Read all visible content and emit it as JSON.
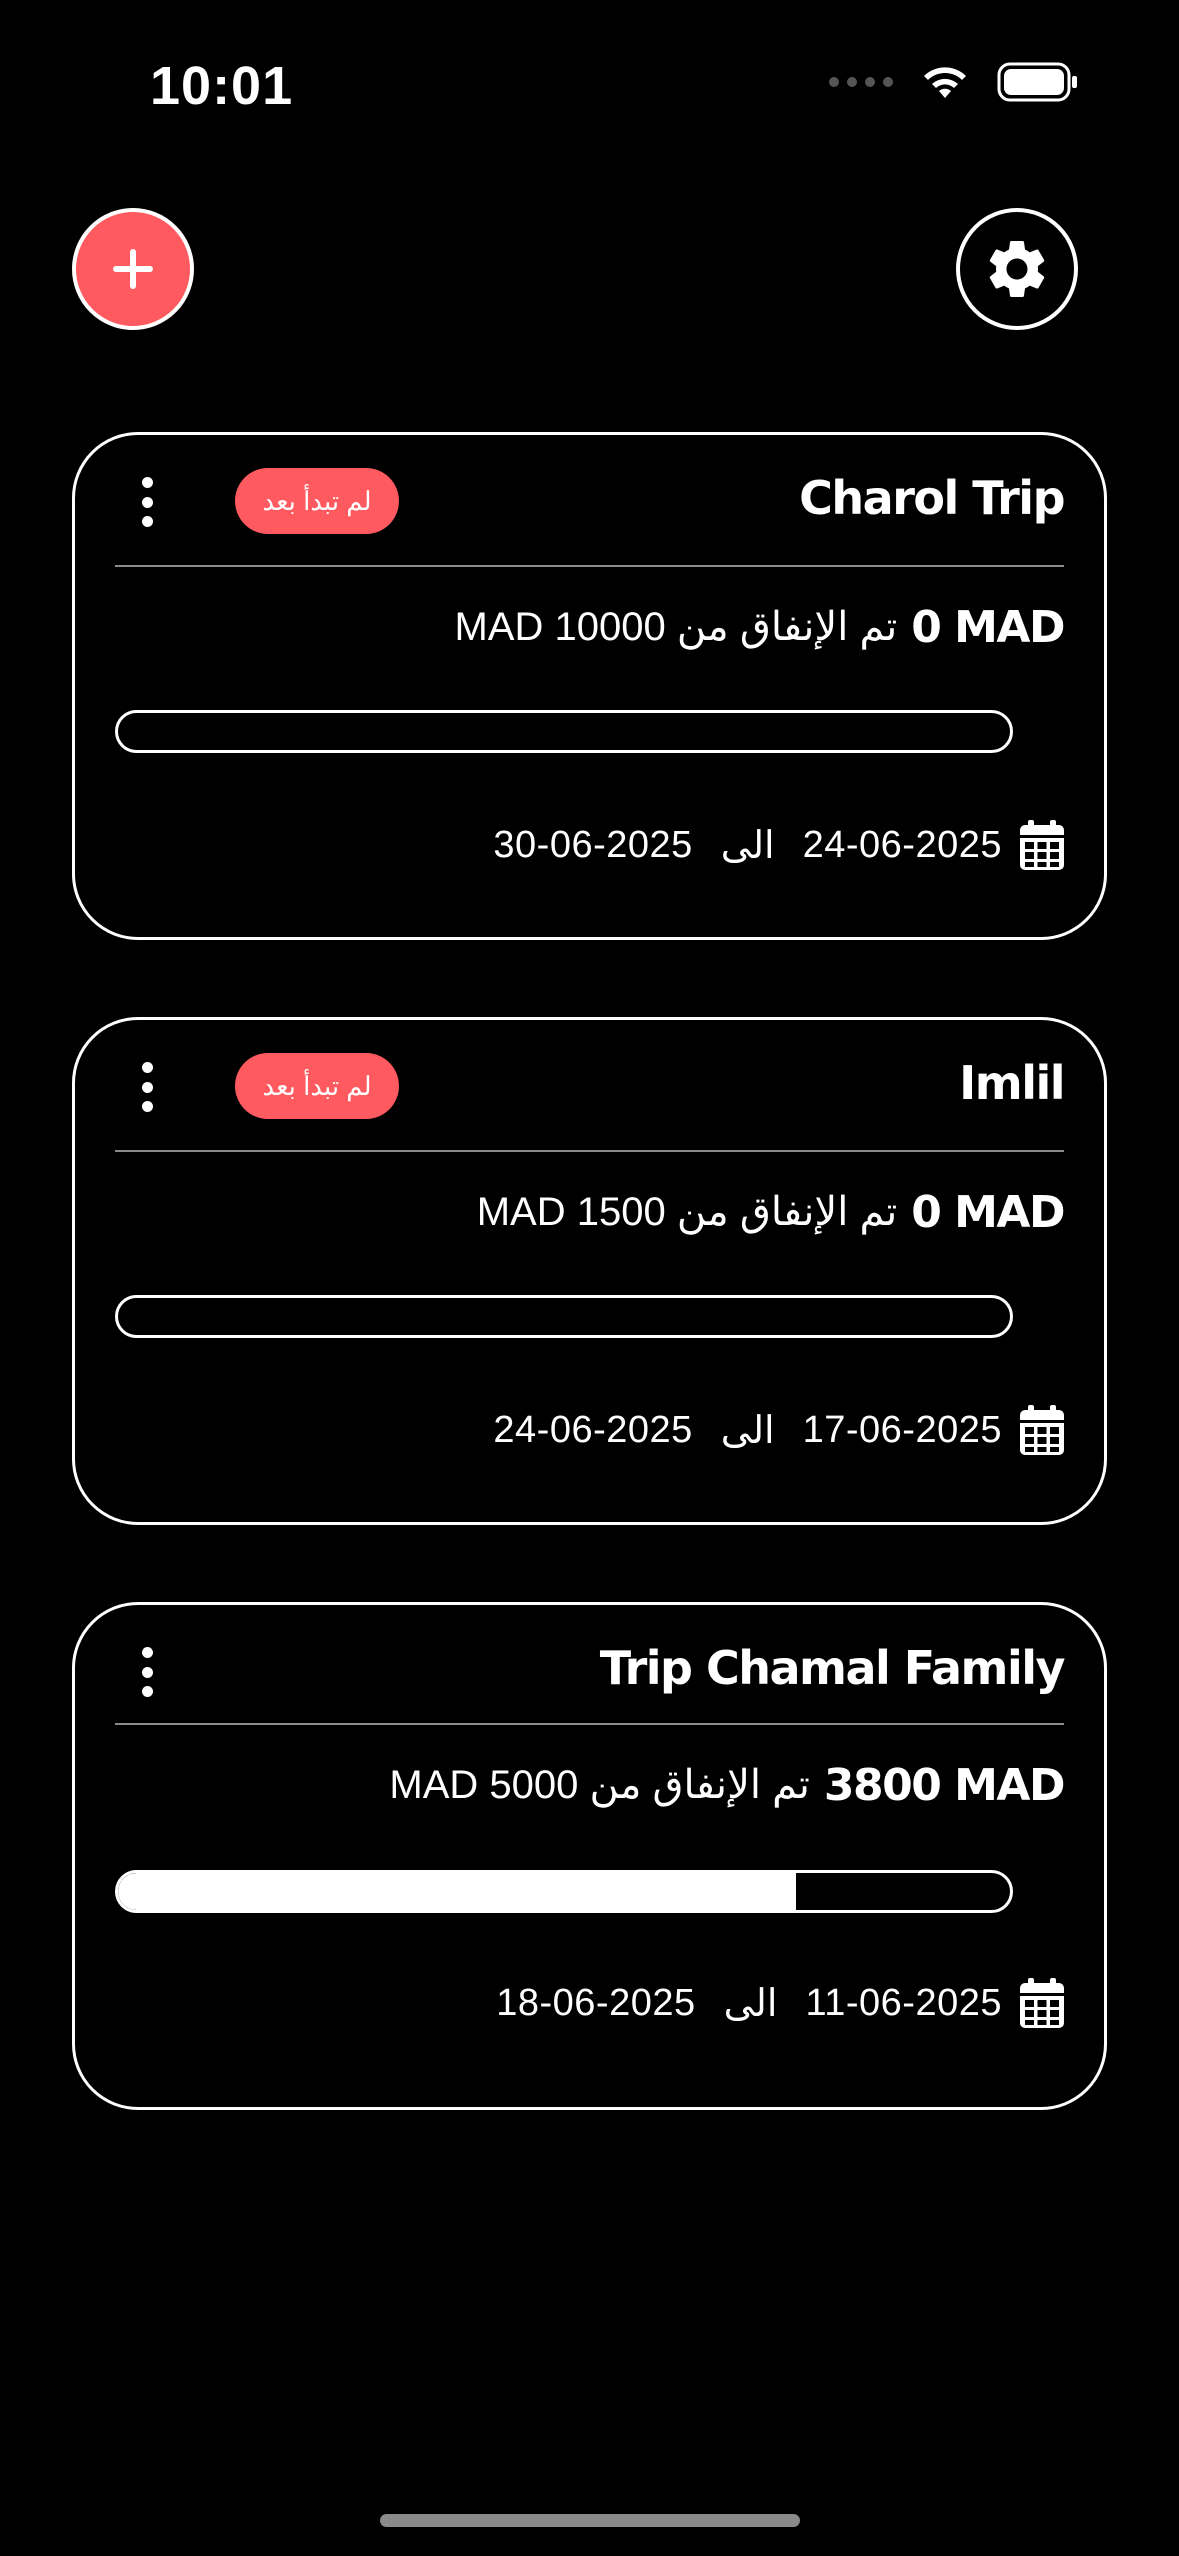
{
  "status_bar": {
    "time": "10:01"
  },
  "colors": {
    "accent": "#ff5a5f",
    "background": "#000000",
    "foreground": "#ffffff"
  },
  "icons": {
    "add": "plus-icon",
    "settings": "gear-icon",
    "menu": "kebab-menu-icon",
    "calendar": "calendar-icon"
  },
  "trips": [
    {
      "title": "Charol Trip",
      "badge": "لم تبدأ بعد",
      "spent_amount": "0 MAD",
      "spent_of": "تم الإنفاق من 10000 MAD",
      "progress": 0,
      "start_date": "24-06-2025",
      "separator": "الى",
      "end_date": "30-06-2025"
    },
    {
      "title": "Imlil",
      "badge": "لم تبدأ بعد",
      "spent_amount": "0 MAD",
      "spent_of": "تم الإنفاق من 1500 MAD",
      "progress": 0,
      "start_date": "17-06-2025",
      "separator": "الى",
      "end_date": "24-06-2025"
    },
    {
      "title": "Trip Chamal Family",
      "badge": "",
      "spent_amount": "3800 MAD",
      "spent_of": "تم الإنفاق من 5000 MAD",
      "progress": 0.76,
      "start_date": "11-06-2025",
      "separator": "الى",
      "end_date": "18-06-2025"
    }
  ]
}
